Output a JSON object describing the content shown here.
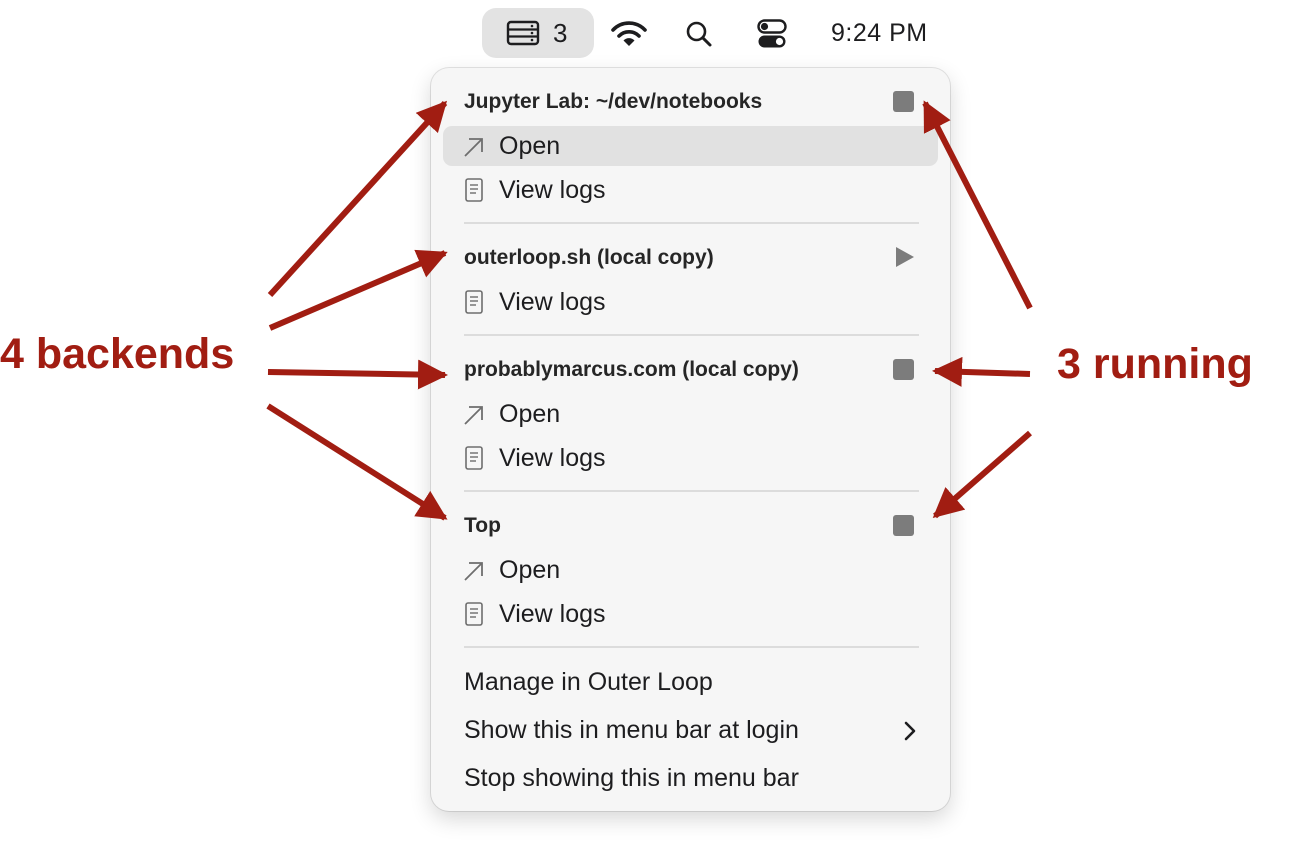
{
  "menubar": {
    "status_item": {
      "icon": "server-stack-icon",
      "count": "3"
    },
    "wifi_icon": "wifi-icon",
    "search_icon": "search-icon",
    "control_center_icon": "control-center-icon",
    "clock": "9:24 PM"
  },
  "menu": {
    "sections": [
      {
        "title": "Jupyter Lab: ~/dev/notebooks",
        "state_icon": "stop-icon",
        "items": [
          {
            "icon": "open-arrow-icon",
            "label": "Open"
          },
          {
            "icon": "log-document-icon",
            "label": "View logs"
          }
        ]
      },
      {
        "title": "outerloop.sh (local copy)",
        "state_icon": "play-icon",
        "items": [
          {
            "icon": "log-document-icon",
            "label": "View logs"
          }
        ]
      },
      {
        "title": "probablymarcus.com (local copy)",
        "state_icon": "stop-icon",
        "items": [
          {
            "icon": "open-arrow-icon",
            "label": "Open"
          },
          {
            "icon": "log-document-icon",
            "label": "View logs"
          }
        ]
      },
      {
        "title": "Top",
        "state_icon": "stop-icon",
        "items": [
          {
            "icon": "open-arrow-icon",
            "label": "Open"
          },
          {
            "icon": "log-document-icon",
            "label": "View logs"
          }
        ]
      }
    ],
    "footer": {
      "manage": "Manage in Outer Loop",
      "show_at_login": "Show this in menu bar at login",
      "stop_showing": "Stop showing this in menu bar"
    }
  },
  "annotations": {
    "left_label": "4 backends",
    "right_label": "3 running",
    "arrow_color": "#a11d12"
  },
  "colors": {
    "menu_background": "#f6f6f6",
    "highlight": "#e1e1e1",
    "stop_square": "#7c7c7c"
  }
}
